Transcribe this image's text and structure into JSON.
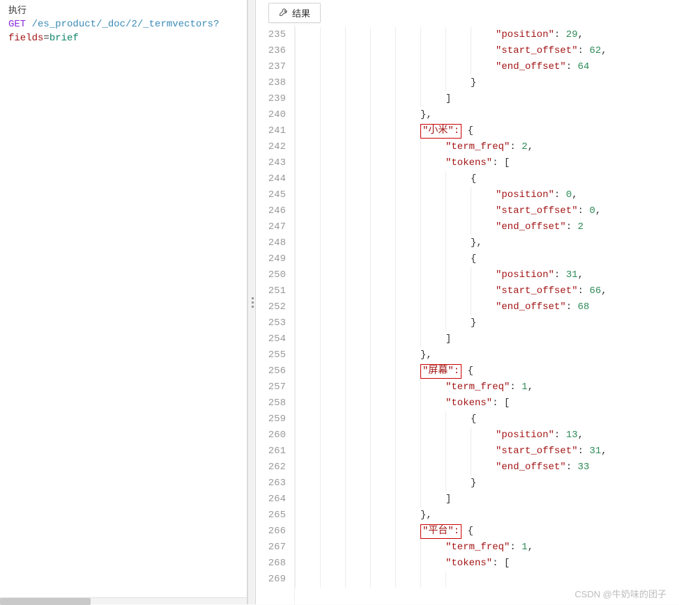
{
  "leftPanel": {
    "label": "执行",
    "method": "GET",
    "path": "/es_product/_doc/2/_termvectors?",
    "paramKey": "fields",
    "equals": "=",
    "paramValue": "brief"
  },
  "tab": {
    "label": "结果"
  },
  "lineNumbers": [
    "235",
    "236",
    "237",
    "238",
    "239",
    "240",
    "241",
    "242",
    "243",
    "244",
    "245",
    "246",
    "247",
    "248",
    "249",
    "250",
    "251",
    "252",
    "253",
    "254",
    "255",
    "256",
    "257",
    "258",
    "259",
    "260",
    "261",
    "262",
    "263",
    "264",
    "265",
    "266",
    "267",
    "268",
    "269"
  ],
  "lines": {
    "l235": {
      "indent": 8,
      "k": "\"position\"",
      "sep": ": ",
      "v": "29",
      "tail": ","
    },
    "l236": {
      "indent": 8,
      "k": "\"start_offset\"",
      "sep": ": ",
      "v": "62",
      "tail": ","
    },
    "l237": {
      "indent": 8,
      "k": "\"end_offset\"",
      "sep": ": ",
      "v": "64"
    },
    "l238": {
      "indent": 7,
      "text": "}"
    },
    "l239": {
      "indent": 6,
      "text": "]"
    },
    "l240": {
      "indent": 5,
      "text": "},"
    },
    "l241": {
      "indent": 5,
      "hl": "\"小米\":",
      "after": " {"
    },
    "l242": {
      "indent": 6,
      "k": "\"term_freq\"",
      "sep": ": ",
      "v": "2",
      "tail": ","
    },
    "l243": {
      "indent": 6,
      "k": "\"tokens\"",
      "sep": ": ",
      "after": "["
    },
    "l244": {
      "indent": 7,
      "text": "{"
    },
    "l245": {
      "indent": 8,
      "k": "\"position\"",
      "sep": ": ",
      "v": "0",
      "tail": ","
    },
    "l246": {
      "indent": 8,
      "k": "\"start_offset\"",
      "sep": ": ",
      "v": "0",
      "tail": ","
    },
    "l247": {
      "indent": 8,
      "k": "\"end_offset\"",
      "sep": ": ",
      "v": "2"
    },
    "l248": {
      "indent": 7,
      "text": "},"
    },
    "l249": {
      "indent": 7,
      "text": "{"
    },
    "l250": {
      "indent": 8,
      "k": "\"position\"",
      "sep": ": ",
      "v": "31",
      "tail": ","
    },
    "l251": {
      "indent": 8,
      "k": "\"start_offset\"",
      "sep": ": ",
      "v": "66",
      "tail": ","
    },
    "l252": {
      "indent": 8,
      "k": "\"end_offset\"",
      "sep": ": ",
      "v": "68"
    },
    "l253": {
      "indent": 7,
      "text": "}"
    },
    "l254": {
      "indent": 6,
      "text": "]"
    },
    "l255": {
      "indent": 5,
      "text": "},"
    },
    "l256": {
      "indent": 5,
      "hl": "\"屏幕\":",
      "after": " {"
    },
    "l257": {
      "indent": 6,
      "k": "\"term_freq\"",
      "sep": ": ",
      "v": "1",
      "tail": ","
    },
    "l258": {
      "indent": 6,
      "k": "\"tokens\"",
      "sep": ": ",
      "after": "["
    },
    "l259": {
      "indent": 7,
      "text": "{"
    },
    "l260": {
      "indent": 8,
      "k": "\"position\"",
      "sep": ": ",
      "v": "13",
      "tail": ","
    },
    "l261": {
      "indent": 8,
      "k": "\"start_offset\"",
      "sep": ": ",
      "v": "31",
      "tail": ","
    },
    "l262": {
      "indent": 8,
      "k": "\"end_offset\"",
      "sep": ": ",
      "v": "33"
    },
    "l263": {
      "indent": 7,
      "text": "}"
    },
    "l264": {
      "indent": 6,
      "text": "]"
    },
    "l265": {
      "indent": 5,
      "text": "},"
    },
    "l266": {
      "indent": 5,
      "hl": "\"平台\":",
      "after": " {"
    },
    "l267": {
      "indent": 6,
      "k": "\"term_freq\"",
      "sep": ": ",
      "v": "1",
      "tail": ","
    },
    "l268": {
      "indent": 6,
      "k": "\"tokens\"",
      "sep": ": ",
      "after": "["
    },
    "l269": {
      "indent": 7,
      "text": ""
    }
  },
  "watermark": "CSDN @牛奶味的团子"
}
